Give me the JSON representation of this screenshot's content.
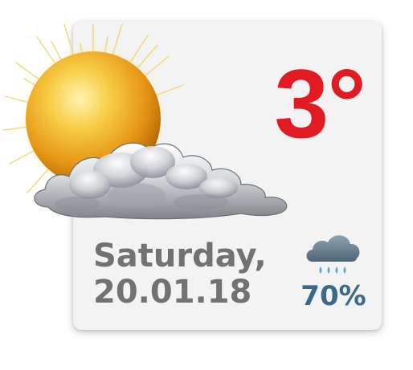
{
  "weather": {
    "temperature": "3°",
    "day": "Saturday,",
    "date": "20.01.18",
    "precipitation": "70%",
    "condition_icon": "sun-behind-cloud-icon",
    "precipitation_icon": "rain-cloud-icon"
  },
  "colors": {
    "temperature": "#e11b22",
    "date_text": "#727272",
    "precipitation_text": "#3b6a84",
    "card_background": "#f3f3f3"
  }
}
